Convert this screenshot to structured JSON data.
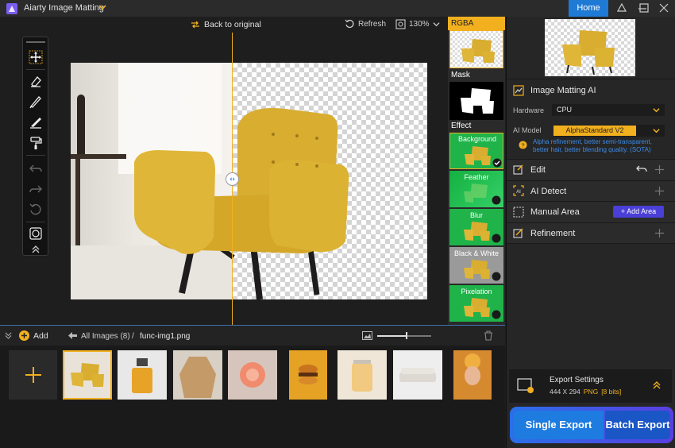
{
  "titlebar": {
    "app_title": "Aiarty Image Matting",
    "home_label": "Home"
  },
  "canvas_toolbar": {
    "back_label": "Back to original",
    "refresh_label": "Refresh",
    "zoom_label": "130%"
  },
  "effects": {
    "rgba_label": "RGBA",
    "mask_label": "Mask",
    "effect_label": "Effect",
    "items": [
      {
        "label": "Background",
        "selected": true
      },
      {
        "label": "Feather",
        "selected": false
      },
      {
        "label": "Blur",
        "selected": false
      },
      {
        "label": "Black & White",
        "selected": false
      },
      {
        "label": "Pixelation",
        "selected": false
      }
    ]
  },
  "props": {
    "matting_title": "Image Matting AI",
    "hardware_label": "Hardware",
    "hardware_value": "CPU",
    "model_label": "AI Model",
    "model_value": "AlphaStandard  V2",
    "model_hint": "Alpha refinement, better semi-transparent, better hair, better blending quality. (SOTA)",
    "edit_label": "Edit",
    "ai_detect_label": "AI Detect",
    "manual_area_label": "Manual Area",
    "add_area_label": "Add Area",
    "refinement_label": "Refinement"
  },
  "bottom_bar": {
    "add_label": "Add",
    "all_images_label": "All Images (8)",
    "separator": "/",
    "current_file": "func-img1.png"
  },
  "export": {
    "settings_label": "Export Settings",
    "dimensions": "444 X 294",
    "format": "PNG",
    "bits": "[8 bits]",
    "single_label": "Single Export",
    "batch_label": "Batch Export"
  },
  "colors": {
    "accent_blue": "#1f7ad6",
    "accent_yellow": "#f2b01e",
    "effect_green": "#1fb34a",
    "add_area_purple": "#4a3fd6"
  }
}
